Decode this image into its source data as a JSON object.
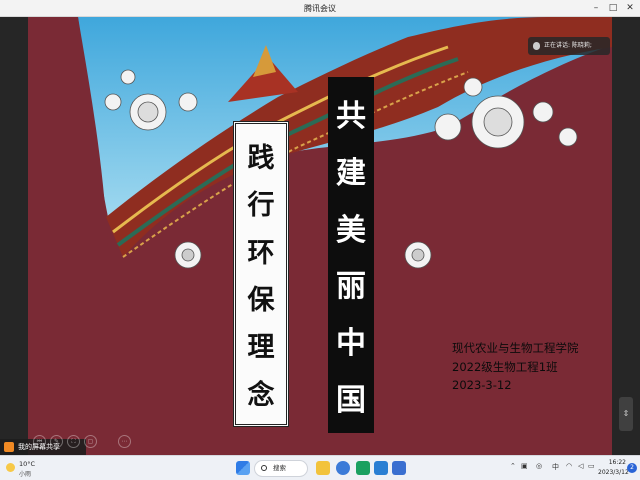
{
  "window": {
    "title": "腾讯会议",
    "minimize": "–",
    "maximize": "□",
    "close": "✕"
  },
  "speaker_toast": {
    "text": "正在讲话: 陈晓莉;"
  },
  "slide": {
    "banner_left": [
      "践",
      "行",
      "环",
      "保",
      "理",
      "念"
    ],
    "banner_right": [
      "共",
      "建",
      "美",
      "丽",
      "中",
      "国"
    ],
    "info": {
      "college": "现代农业与生物工程学院",
      "class": "2022级生物工程1班",
      "date": "2023-3-12"
    },
    "colors": {
      "background": "#7a2a35",
      "sky": "#56b4de",
      "roof": "#8f2d20"
    }
  },
  "meeting_controls": {
    "share_label": "我的屏幕共享",
    "buttons": [
      "⏮",
      "✎",
      "⛶",
      "▢",
      "⋯"
    ]
  },
  "taskbar": {
    "weather": {
      "temp": "10°C",
      "desc": "小雨"
    },
    "search_placeholder": "搜索",
    "tray": {
      "lang": "中"
    },
    "clock": {
      "time": "16:22",
      "date": "2023/3/12"
    },
    "notifications": "2"
  }
}
